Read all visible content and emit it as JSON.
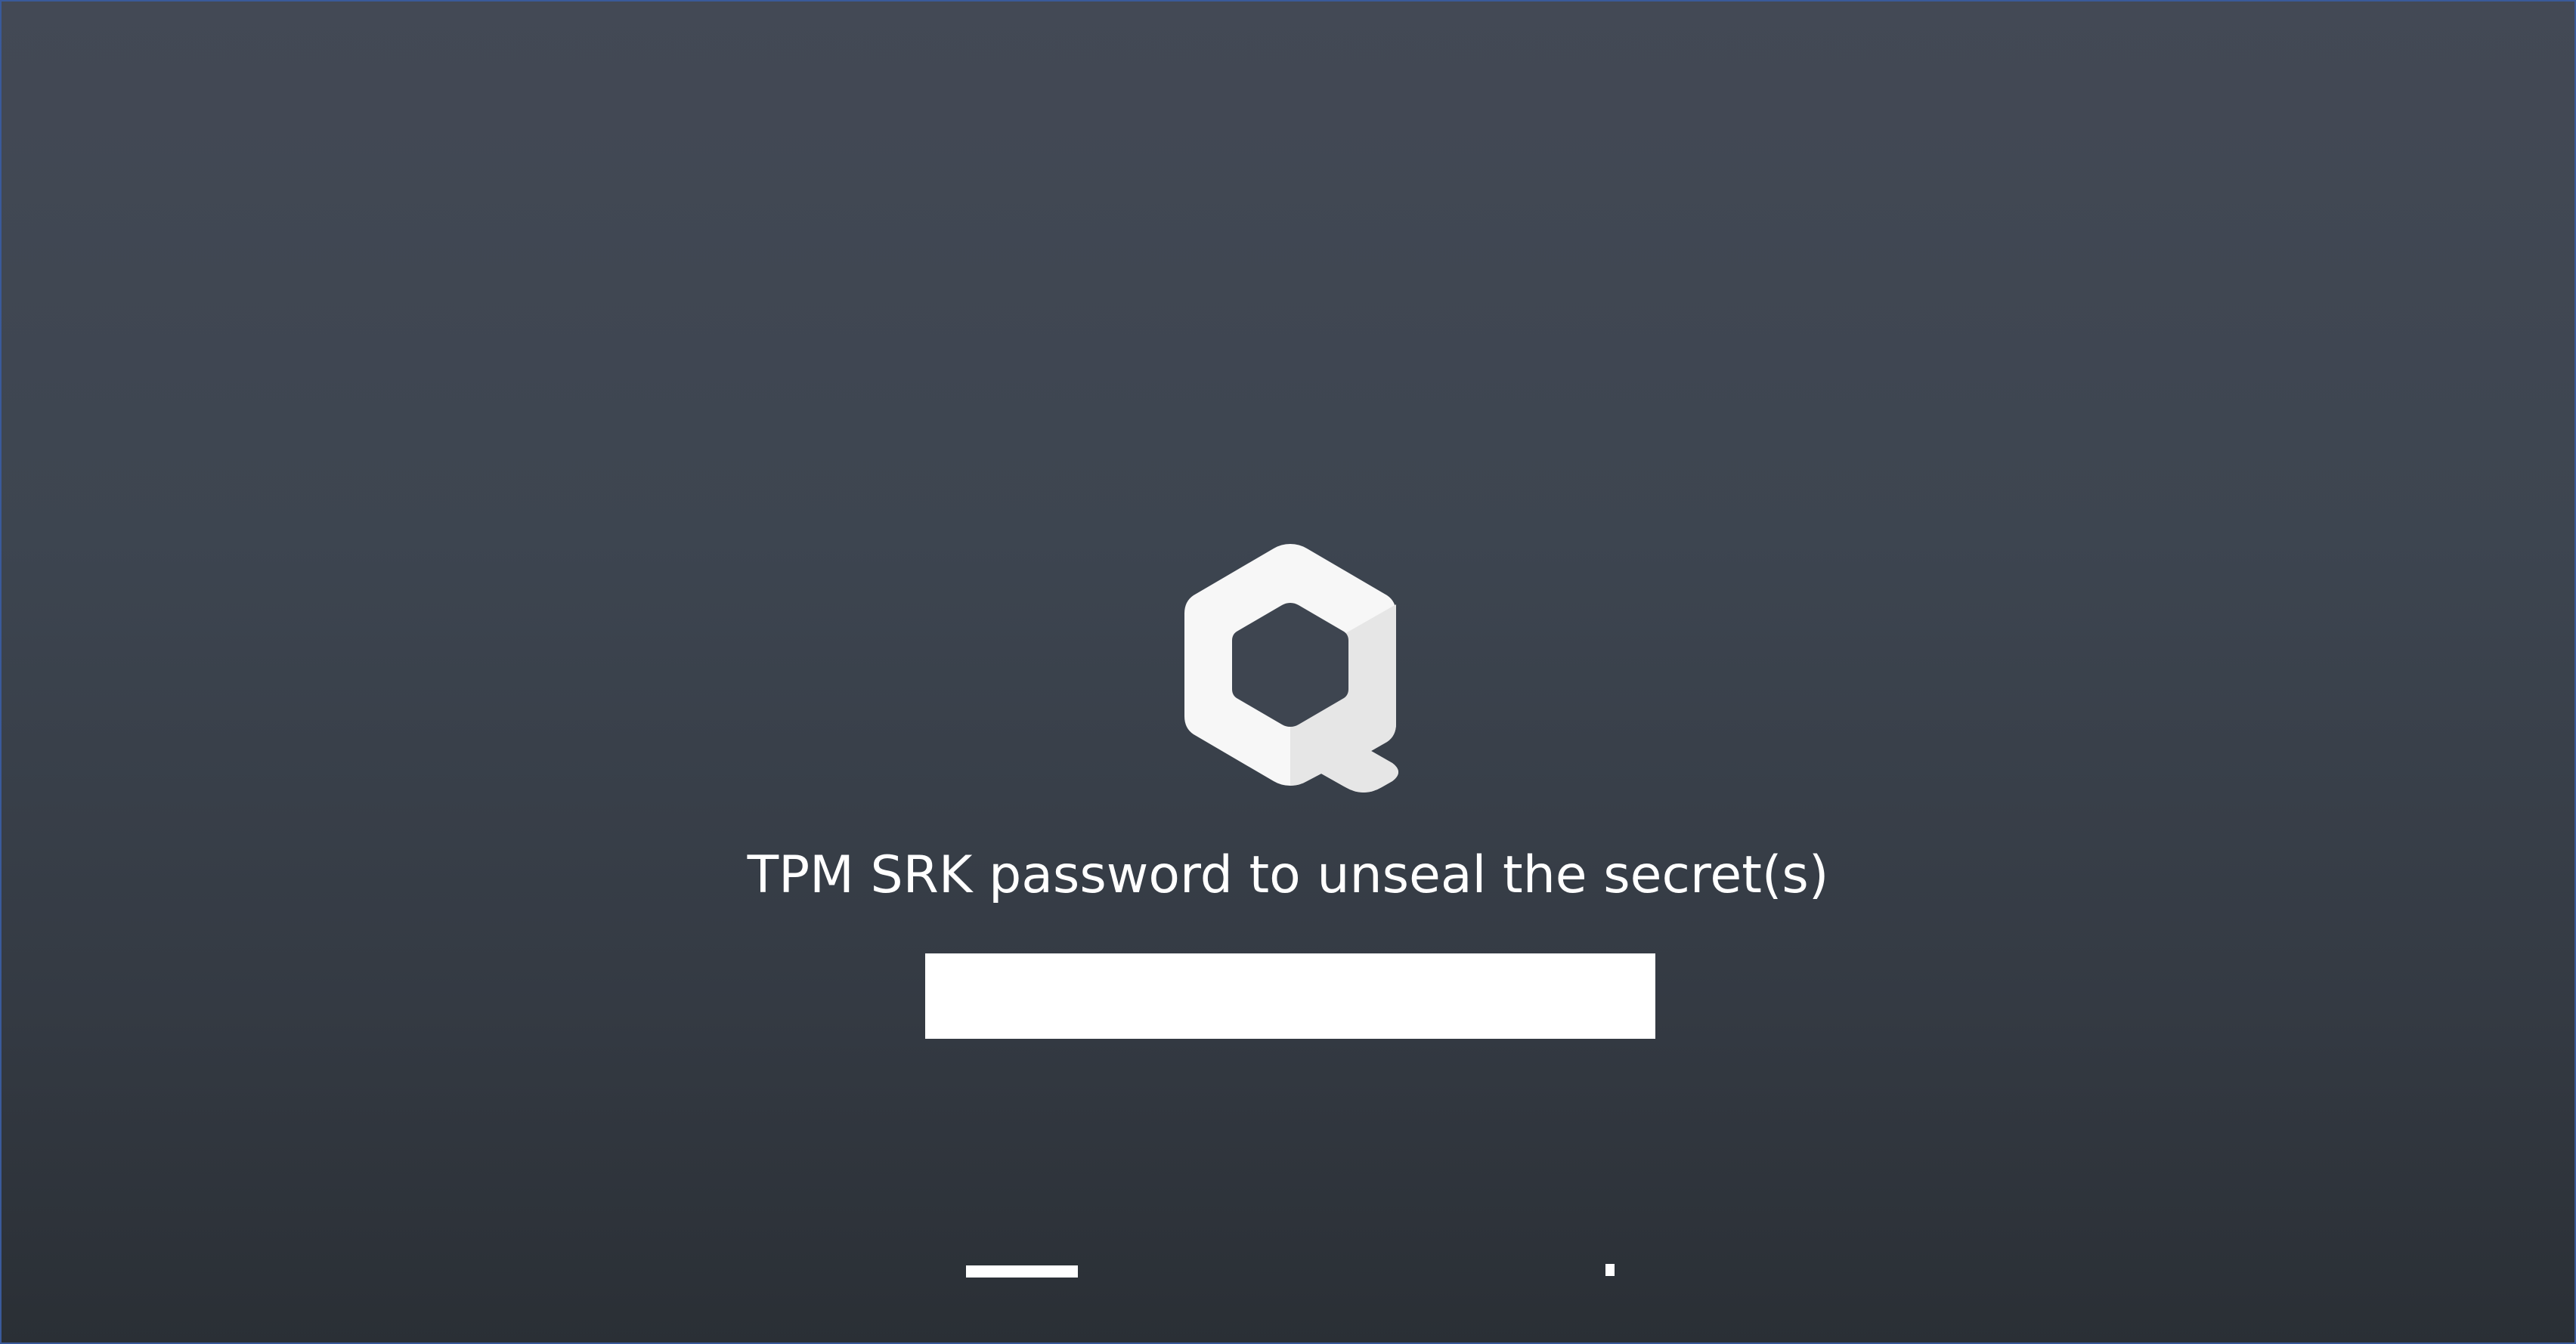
{
  "prompt": {
    "text": "TPM SRK password to unseal the secret(s)"
  },
  "password_field": {
    "value": "",
    "placeholder": "",
    "type": "password"
  },
  "logo": {
    "icon": "qubes-logo-icon",
    "color": "#f7f7f7"
  },
  "progress": {
    "indicator": "boot-progress",
    "color": "#ffffff"
  },
  "colors": {
    "background_top": "#434955",
    "background_bottom": "#2a2f35",
    "text": "#ffffff"
  }
}
